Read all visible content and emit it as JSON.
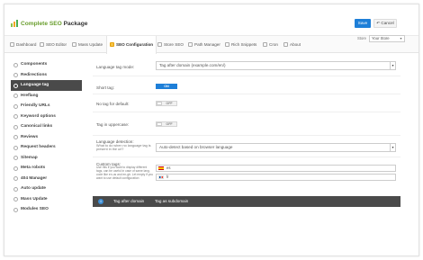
{
  "app": {
    "title_main": "Complete SEO",
    "title_rest": " Package"
  },
  "header": {
    "save_label": "Save",
    "cancel_label": "Cancel"
  },
  "tabs": [
    {
      "label": "Dashboard",
      "active": false,
      "icon": "dashboard-icon"
    },
    {
      "label": "SEO Editor",
      "active": false,
      "icon": "editor-icon"
    },
    {
      "label": "Mass Update",
      "active": false,
      "icon": "update-icon"
    },
    {
      "label": "SEO Configuration",
      "active": true,
      "icon": "wrench-icon"
    },
    {
      "label": "Store SEO",
      "active": false,
      "icon": "store-icon"
    },
    {
      "label": "Path Manager",
      "active": false,
      "icon": "path-icon"
    },
    {
      "label": "Rich Snippets",
      "active": false,
      "icon": "snippet-icon"
    },
    {
      "label": "Cron",
      "active": false,
      "icon": "cron-icon"
    },
    {
      "label": "About",
      "active": false,
      "icon": "info-icon"
    }
  ],
  "store": {
    "label": "Store",
    "value": "Your Store"
  },
  "sidebar": {
    "items": [
      {
        "label": "Components",
        "active": false
      },
      {
        "label": "Redirections",
        "active": false
      },
      {
        "label": "Language tag",
        "active": true
      },
      {
        "label": "Hreflang",
        "active": false
      },
      {
        "label": "Friendly URLs",
        "active": false
      },
      {
        "label": "Keyword options",
        "active": false
      },
      {
        "label": "Canonical links",
        "active": false
      },
      {
        "label": "Reviews",
        "active": false
      },
      {
        "label": "Request headers",
        "active": false
      },
      {
        "label": "Sitemap",
        "active": false
      },
      {
        "label": "Meta robots",
        "active": false
      },
      {
        "label": "404 Manager",
        "active": false
      },
      {
        "label": "Auto update",
        "active": false
      },
      {
        "label": "Mass Update",
        "active": false
      },
      {
        "label": "Modules SEO",
        "active": false
      }
    ]
  },
  "form": {
    "language_tag_mode": {
      "label": "Language tag mode:",
      "value": "Tag after domain (example.com/en/)"
    },
    "short_tag": {
      "label": "Short tag:",
      "state": "ON"
    },
    "no_tag_default": {
      "label": "No tag for default:",
      "state": "OFF"
    },
    "tag_uppercase": {
      "label": "Tag in uppercase:",
      "state": "OFF"
    },
    "language_detection": {
      "label": "Language detection:",
      "sublabel": "What to do when no language tag is present in the url?",
      "value": "Auto-detect based on browser language"
    },
    "custom_tags": {
      "label": "Custom tags:",
      "sublabel": "Use this if you want to display different tags, can be useful in case of same lang. code like en-us and en-gb. Let empty if you want to use default configuration",
      "entries": [
        {
          "flag": "es",
          "value": "es"
        },
        {
          "flag": "fr",
          "value": "fr"
        }
      ]
    }
  },
  "info_bar": {
    "text_1": "Tag after domain",
    "text_2": "Tag as subdomain"
  },
  "colors": {
    "primary": "#1e7fd8",
    "dark": "#4a4a4a",
    "brand_green": "#6a9e2e"
  }
}
